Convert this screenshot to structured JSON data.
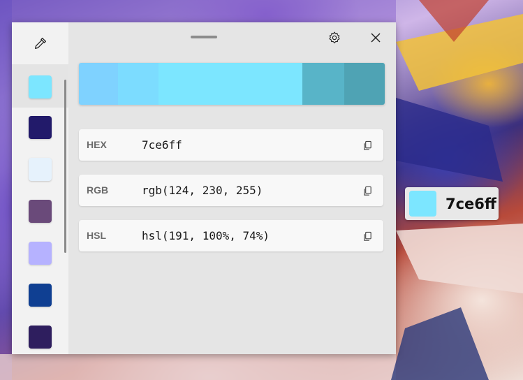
{
  "selected_color": {
    "hex": "7ce6ff",
    "swatch_color": "#7ce6ff"
  },
  "history": [
    {
      "color": "#7ce6ff"
    },
    {
      "color": "#221a6a"
    },
    {
      "color": "#e6f2fc"
    },
    {
      "color": "#6a4a7a"
    },
    {
      "color": "#b6b2ff"
    },
    {
      "color": "#0f3f92"
    },
    {
      "color": "#2e1e5e"
    }
  ],
  "shades": [
    {
      "color": "#7fd2ff"
    },
    {
      "color": "#7cdcff"
    },
    {
      "color": "#7ce6ff"
    },
    {
      "color": "#58b4c8"
    },
    {
      "color": "#4fa3b4"
    }
  ],
  "values": [
    {
      "label": "HEX",
      "value": "7ce6ff"
    },
    {
      "label": "RGB",
      "value": "rgb(124, 230, 255)"
    },
    {
      "label": "HSL",
      "value": "hsl(191, 100%, 74%)"
    }
  ],
  "overlay": {
    "hex": "7ce6ff",
    "swatch_color": "#7ce6ff"
  },
  "icons": {
    "picker": "eyedropper-icon",
    "settings": "gear-icon",
    "close": "close-icon",
    "copy": "copy-icon"
  }
}
